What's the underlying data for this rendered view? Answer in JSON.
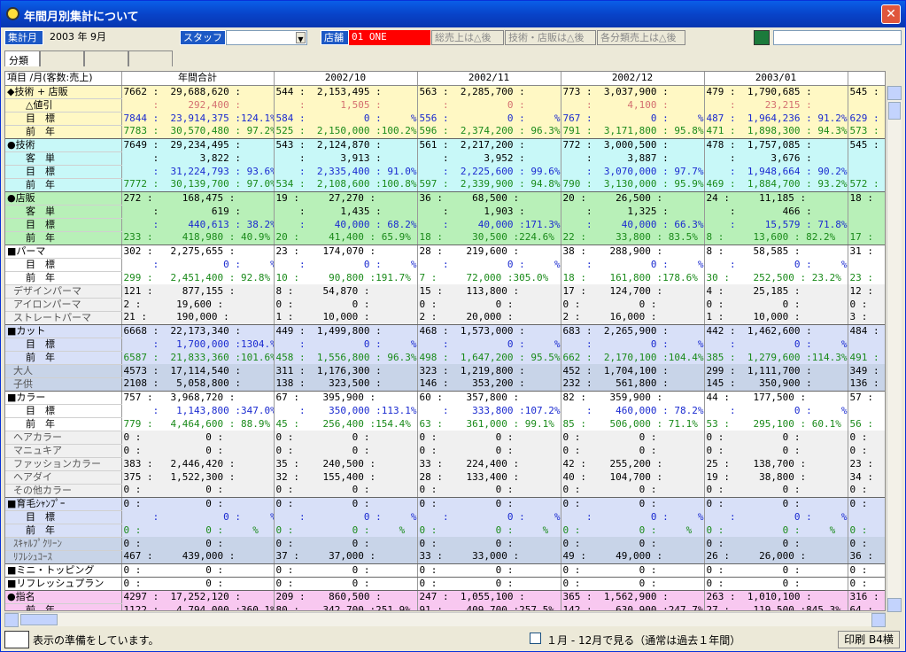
{
  "window": {
    "title": "年間月別集計について",
    "close": "✕"
  },
  "toolbar": {
    "period_label": "集計月",
    "period_value": "2003 年  9月",
    "staff_label": "スタッフ",
    "store_label": "店舗",
    "store_value": "01 ONE",
    "btn_total": "総売上は△後",
    "btn_tech": "技術・店販は△後",
    "btn_cat": "各分類売上は△後"
  },
  "tabs": [
    "分類",
    "",
    "",
    ""
  ],
  "columns": [
    "項目 /月(客数:売上)",
    "年間合計",
    "2002/10",
    "2002/11",
    "2002/12",
    "2003/01"
  ],
  "rows": [
    {
      "label": "◆技術 + 店販",
      "bg": "#fff8c4",
      "c": [
        "7662 :  29,688,620 :",
        "544 :  2,153,495 :",
        "563 :  2,285,700 :",
        "773 :  3,037,900 :",
        "479 :  1,790,685 :",
        "545 :"
      ],
      "col": "#000"
    },
    {
      "label": "      △値引",
      "bg": "#fff8c4",
      "c": [
        "     :     292,400 :",
        "    :      1,505 :",
        "    :          0 :",
        "    :      4,100 :",
        "    :     23,215 :",
        ""
      ],
      "col": "#d47070"
    },
    {
      "label": "      目　標",
      "bg": "#fff8c4",
      "c": [
        "7844 :  23,914,375 :124.1%",
        "584 :          0 :     %",
        "556 :          0 :     %",
        "767 :          0 :     %",
        "487 :  1,964,236 : 91.2%",
        "629 :"
      ],
      "col": "#1a2ad0"
    },
    {
      "label": "      前　年",
      "bg": "#fff8c4",
      "c": [
        "7783 :  30,570,480 : 97.2%",
        "525 :  2,150,000 :100.2%",
        "596 :  2,374,200 : 96.3%",
        "791 :  3,171,800 : 95.8%",
        "471 :  1,898,300 : 94.3%",
        "573 :"
      ],
      "col": "#1a8a1a",
      "sep": 1
    },
    {
      "label": "●技術",
      "bg": "#c8f8f8",
      "c": [
        "7649 :  29,234,495 :",
        "543 :  2,124,870 :",
        "561 :  2,217,200 :",
        "772 :  3,000,500 :",
        "478 :  1,757,085 :",
        "545 :"
      ],
      "col": "#000"
    },
    {
      "label": "      客　単",
      "bg": "#c8f8f8",
      "c": [
        "     :       3,822 :",
        "    :      3,913 :",
        "    :      3,952 :",
        "    :      3,887 :",
        "    :      3,676 :",
        ""
      ],
      "col": "#000"
    },
    {
      "label": "      目　標",
      "bg": "#c8f8f8",
      "c": [
        "     :  31,224,793 : 93.6%",
        "    :  2,335,400 : 91.0%",
        "    :  2,225,600 : 99.6%",
        "    :  3,070,000 : 97.7%",
        "    :  1,948,664 : 90.2%",
        ""
      ],
      "col": "#1a2ad0"
    },
    {
      "label": "      前　年",
      "bg": "#c8f8f8",
      "c": [
        "7772 :  30,139,700 : 97.0%",
        "534 :  2,108,600 :100.8%",
        "597 :  2,339,900 : 94.8%",
        "790 :  3,130,000 : 95.9%",
        "469 :  1,884,700 : 93.2%",
        "572 :"
      ],
      "col": "#1a8a1a",
      "sep": 1
    },
    {
      "label": "●店販",
      "bg": "#b8f0b8",
      "c": [
        "272 :     168,475 :",
        "19 :     27,270 :",
        "36 :     68,500 :",
        "20 :     26,500 :",
        "24 :     11,185 :",
        "18 :"
      ],
      "col": "#000"
    },
    {
      "label": "      客　単",
      "bg": "#b8f0b8",
      "c": [
        "     :         619 :",
        "    :      1,435 :",
        "    :      1,903 :",
        "    :      1,325 :",
        "    :        466 :",
        ""
      ],
      "col": "#000"
    },
    {
      "label": "      目　標",
      "bg": "#b8f0b8",
      "c": [
        "     :     440,613 : 38.2%",
        "    :     40,000 : 68.2%",
        "    :     40,000 :171.3%",
        "    :     40,000 : 66.3%",
        "    :     15,579 : 71.8%",
        ""
      ],
      "col": "#1a2ad0"
    },
    {
      "label": "      前　年",
      "bg": "#b8f0b8",
      "c": [
        "233 :     418,980 : 40.9%",
        "20 :     41,400 : 65.9%",
        "18 :     30,500 :224.6%",
        "22 :     33,800 : 83.5%",
        "8 :     13,600 : 82.2%",
        "17 :"
      ],
      "col": "#1a8a1a",
      "sep": 1
    },
    {
      "label": "■パーマ",
      "bg": "#ffffff",
      "c": [
        "302 :   2,275,655 :",
        "23 :    174,070 :",
        "28 :    219,600 :",
        "38 :    288,900 :",
        "8 :     58,585 :",
        "31 :"
      ],
      "col": "#000"
    },
    {
      "label": "      目　標",
      "bg": "#ffffff",
      "c": [
        "     :           0 :     %",
        "    :          0 :     %",
        "    :          0 :     %",
        "    :          0 :     %",
        "    :          0 :     %",
        ""
      ],
      "col": "#1a2ad0"
    },
    {
      "label": "      前　年",
      "bg": "#ffffff",
      "c": [
        "299 :   2,451,400 : 92.8%",
        "10 :     90,800 :191.7%",
        "7 :     72,000 :305.0%",
        "18 :    161,800 :178.6%",
        "30 :    252,500 : 23.2%",
        "23 :"
      ],
      "col": "#1a8a1a"
    },
    {
      "label": "  デザインパーマ",
      "bg": "#f0f0f0",
      "c": [
        "121 :     877,155 :",
        "8 :     54,870 :",
        "15 :    113,800 :",
        "17 :    124,700 :",
        "4 :     25,185 :",
        "12 :"
      ],
      "col": "#000",
      "lc": "#555"
    },
    {
      "label": "  アイロンパーマ",
      "bg": "#f0f0f0",
      "c": [
        "2 :      19,600 :",
        "0 :          0 :",
        "0 :          0 :",
        "0 :          0 :",
        "0 :          0 :",
        "0 :"
      ],
      "col": "#000",
      "lc": "#555"
    },
    {
      "label": "  ストレートパーマ",
      "bg": "#f0f0f0",
      "c": [
        "21 :     190,000 :",
        "1 :     10,000 :",
        "2 :     20,000 :",
        "2 :     16,000 :",
        "1 :     10,000 :",
        "3 :"
      ],
      "col": "#000",
      "lc": "#555",
      "sep": 1
    },
    {
      "label": "■カット",
      "bg": "#d8e0f8",
      "c": [
        "6668 :  22,173,340 :",
        "449 :  1,499,800 :",
        "468 :  1,573,000 :",
        "683 :  2,265,900 :",
        "442 :  1,462,600 :",
        "484 :"
      ],
      "col": "#000"
    },
    {
      "label": "      目　標",
      "bg": "#d8e0f8",
      "c": [
        "     :   1,700,000 :1304.%",
        "    :          0 :     %",
        "    :          0 :     %",
        "    :          0 :     %",
        "    :          0 :     %",
        ""
      ],
      "col": "#1a2ad0"
    },
    {
      "label": "      前　年",
      "bg": "#d8e0f8",
      "c": [
        "6587 :  21,833,360 :101.6%",
        "458 :  1,556,800 : 96.3%",
        "498 :  1,647,200 : 95.5%",
        "662 :  2,170,100 :104.4%",
        "385 :  1,279,600 :114.3%",
        "491 :"
      ],
      "col": "#1a8a1a"
    },
    {
      "label": "  大人",
      "bg": "#c8d4e8",
      "c": [
        "4573 :  17,114,540 :",
        "311 :  1,176,300 :",
        "323 :  1,219,800 :",
        "452 :  1,704,100 :",
        "299 :  1,111,700 :",
        "349 :"
      ],
      "col": "#000",
      "lc": "#555"
    },
    {
      "label": "  子供",
      "bg": "#c8d4e8",
      "c": [
        "2108 :   5,058,800 :",
        "138 :    323,500 :",
        "146 :    353,200 :",
        "232 :    561,800 :",
        "145 :    350,900 :",
        "136 :"
      ],
      "col": "#000",
      "lc": "#555",
      "sep": 1
    },
    {
      "label": "■カラー",
      "bg": "#ffffff",
      "c": [
        "757 :   3,968,720 :",
        "67 :    395,900 :",
        "60 :    357,800 :",
        "82 :    359,900 :",
        "44 :    177,500 :",
        "57 :"
      ],
      "col": "#000"
    },
    {
      "label": "      目　標",
      "bg": "#ffffff",
      "c": [
        "     :   1,143,800 :347.0%",
        "    :    350,000 :113.1%",
        "    :    333,800 :107.2%",
        "    :    460,000 : 78.2%",
        "    :          0 :     %",
        ""
      ],
      "col": "#1a2ad0"
    },
    {
      "label": "      前　年",
      "bg": "#ffffff",
      "c": [
        "779 :   4,464,600 : 88.9%",
        "45 :    256,400 :154.4%",
        "63 :    361,000 : 99.1%",
        "85 :    506,000 : 71.1%",
        "53 :    295,100 : 60.1%",
        "56 :"
      ],
      "col": "#1a8a1a"
    },
    {
      "label": "  ヘアカラー",
      "bg": "#f0f0f0",
      "c": [
        "0 :           0 :",
        "0 :          0 :",
        "0 :          0 :",
        "0 :          0 :",
        "0 :          0 :",
        "0 :"
      ],
      "col": "#000",
      "lc": "#555"
    },
    {
      "label": "  マニュキア",
      "bg": "#f0f0f0",
      "c": [
        "0 :           0 :",
        "0 :          0 :",
        "0 :          0 :",
        "0 :          0 :",
        "0 :          0 :",
        "0 :"
      ],
      "col": "#000",
      "lc": "#555"
    },
    {
      "label": "  ファッションカラー",
      "bg": "#f0f0f0",
      "c": [
        "383 :   2,446,420 :",
        "35 :    240,500 :",
        "33 :    224,400 :",
        "42 :    255,200 :",
        "25 :    138,700 :",
        "23 :"
      ],
      "col": "#000",
      "lc": "#555"
    },
    {
      "label": "  ヘアダイ",
      "bg": "#f0f0f0",
      "c": [
        "375 :   1,522,300 :",
        "32 :    155,400 :",
        "28 :    133,400 :",
        "40 :    104,700 :",
        "19 :     38,800 :",
        "34 :"
      ],
      "col": "#000",
      "lc": "#555"
    },
    {
      "label": "  その他カラー",
      "bg": "#f0f0f0",
      "c": [
        "0 :           0 :",
        "0 :          0 :",
        "0 :          0 :",
        "0 :          0 :",
        "0 :          0 :",
        "0 :"
      ],
      "col": "#000",
      "lc": "#555",
      "sep": 1
    },
    {
      "label": "■育毛ｼｬﾝﾌﾟｰ",
      "bg": "#d8e0f8",
      "c": [
        "0 :           0 :",
        "0 :          0 :",
        "0 :          0 :",
        "0 :          0 :",
        "0 :          0 :",
        "0 :"
      ],
      "col": "#000"
    },
    {
      "label": "      目　標",
      "bg": "#d8e0f8",
      "c": [
        "     :           0 :     %",
        "    :          0 :     %",
        "    :          0 :     %",
        "    :          0 :     %",
        "    :          0 :     %",
        ""
      ],
      "col": "#1a2ad0"
    },
    {
      "label": "      前　年",
      "bg": "#d8e0f8",
      "c": [
        "0 :           0 :     %",
        "0 :          0 :     %",
        "0 :          0 :     %",
        "0 :          0 :     %",
        "0 :          0 :     %",
        "0 :"
      ],
      "col": "#1a8a1a"
    },
    {
      "label": "  ｽｷｬﾙﾌﾟｸﾘｰﾝ",
      "bg": "#c8d4e8",
      "c": [
        "0 :           0 :",
        "0 :          0 :",
        "0 :          0 :",
        "0 :          0 :",
        "0 :          0 :",
        "0 :"
      ],
      "col": "#000",
      "lc": "#555"
    },
    {
      "label": "  ﾘﾌﾚｼｭｺｰｽ",
      "bg": "#c8d4e8",
      "c": [
        "467 :     439,000 :",
        "37 :     37,000 :",
        "33 :     33,000 :",
        "49 :     49,000 :",
        "26 :     26,000 :",
        "36 :"
      ],
      "col": "#000",
      "lc": "#555",
      "sep": 1
    },
    {
      "label": "■ミニ・トッピング",
      "bg": "#ffffff",
      "c": [
        "0 :           0 :",
        "0 :          0 :",
        "0 :          0 :",
        "0 :          0 :",
        "0 :          0 :",
        "0 :"
      ],
      "col": "#000",
      "sep": 1
    },
    {
      "label": "■リフレッシュプラン",
      "bg": "#ffffff",
      "c": [
        "0 :           0 :",
        "0 :          0 :",
        "0 :          0 :",
        "0 :          0 :",
        "0 :          0 :",
        "0 :"
      ],
      "col": "#000",
      "sep": 1
    },
    {
      "label": "●指名",
      "bg": "#f8c8f0",
      "c": [
        "4297 :  17,252,120 :",
        "209 :    860,500 :",
        "247 :  1,055,100 :",
        "365 :  1,562,900 :",
        "263 :  1,010,100 :",
        "316 :"
      ],
      "col": "#000"
    },
    {
      "label": "      前　年",
      "bg": "#f8c8f0",
      "c": [
        "1122 :   4,794,000 :360.1%",
        "80 :    342,700 :251.9%",
        "91 :    409,700 :257.5%",
        "142 :    630,900 :247.7%",
        "27 :    119,500 :845.3%",
        "64 :"
      ],
      "col": "#000"
    }
  ],
  "status": {
    "message": "表示の準備をしています。",
    "checkbox_label": "１月 - 12月で見る（通常は過去１年間）",
    "print_button": "印刷 B4横"
  }
}
